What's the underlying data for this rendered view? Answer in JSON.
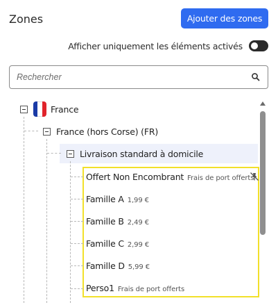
{
  "header": {
    "title": "Zones",
    "add_button": "Ajouter des zones"
  },
  "filter": {
    "toggle_label": "Afficher uniquement les éléments activés",
    "toggle_on": false
  },
  "search": {
    "placeholder": "Rechercher",
    "icon": "search-icon"
  },
  "tree": {
    "country": {
      "label": "France",
      "flag_colors": [
        "#1a3aa6",
        "#ffffff",
        "#e0232b"
      ]
    },
    "region": {
      "label": "France (hors Corse) (FR)"
    },
    "method": {
      "label": "Livraison standard à domicile"
    },
    "items": [
      {
        "name": "Offert Non Encombrant",
        "sub": "Frais de port offerts"
      },
      {
        "name": "Famille A",
        "sub": "1,99 €"
      },
      {
        "name": "Famille B",
        "sub": "2,49 €"
      },
      {
        "name": "Famille C",
        "sub": "2,99 €"
      },
      {
        "name": "Famille D",
        "sub": "5,99 €"
      },
      {
        "name": "Perso1",
        "sub": "Frais de port offerts"
      }
    ]
  },
  "colors": {
    "accent": "#2f6bf0",
    "highlight": "#eef1fb",
    "selection_border": "#f2e02a"
  }
}
